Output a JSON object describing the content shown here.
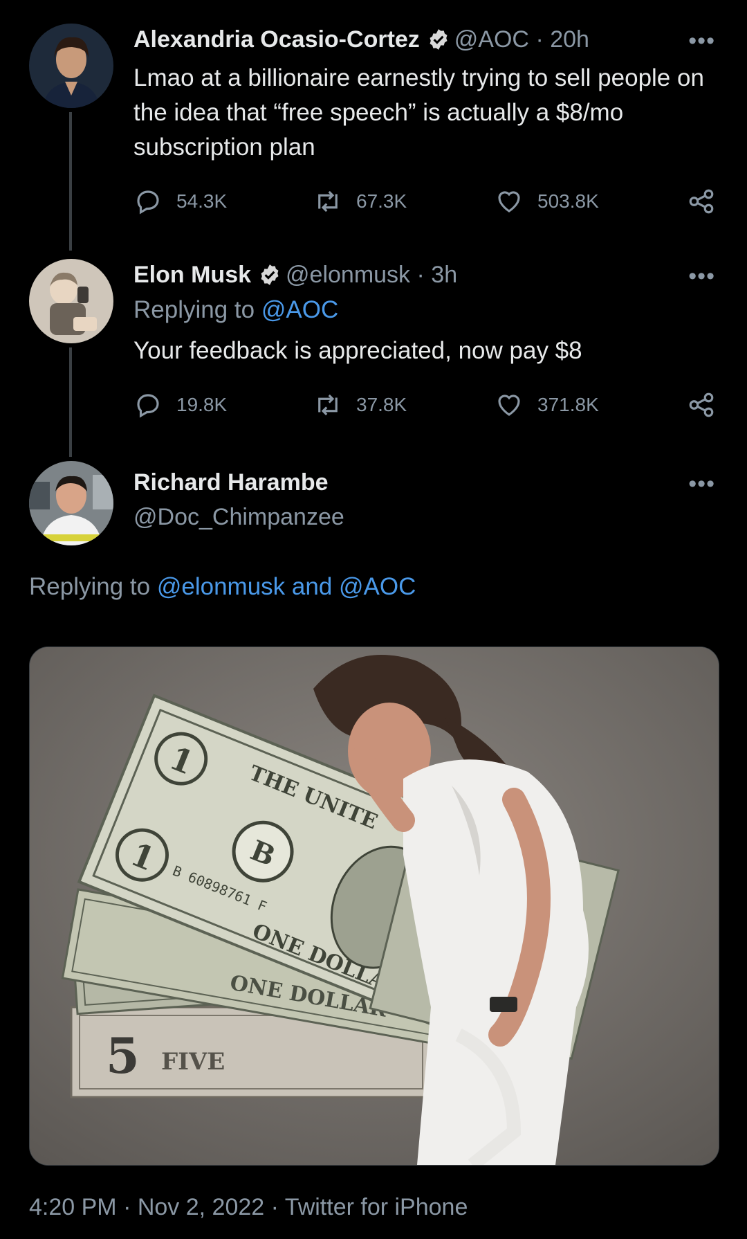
{
  "tweets": [
    {
      "name": "Alexandria Ocasio-Cortez",
      "handle": "@AOC",
      "time": "· 20h",
      "text": "Lmao at a billionaire earnestly trying to sell people on the idea that “free speech” is actually a $8/mo subscription plan",
      "replies": "54.3K",
      "retweets": "67.3K",
      "likes": "503.8K"
    },
    {
      "name": "Elon Musk",
      "handle": "@elonmusk",
      "time": "· 3h",
      "replying_prefix": "Replying to",
      "replying_to": "@AOC",
      "text": "Your feedback is appreciated, now pay $8",
      "replies": "19.8K",
      "retweets": "37.8K",
      "likes": "371.8K"
    },
    {
      "name": "Richard Harambe",
      "handle": "@Doc_Chimpanzee",
      "replying_prefix": "Replying to",
      "replying_to": "@elonmusk and @AOC"
    }
  ],
  "more_glyph": "•••",
  "media": {
    "bill_text_1": "THE UNITE",
    "bill_text_2": "ONE DOLLAR",
    "bill_text_3": "FIVE",
    "bill_serial": "B 60898761 F"
  },
  "footer": {
    "time": "4:20 PM",
    "date": "· Nov 2, 2022",
    "source": "· Twitter for iPhone"
  },
  "colors": {
    "background": "#000000",
    "link": "#4a99e9",
    "muted": "#8b98a5",
    "verified": "#d9d9d9"
  },
  "icons": [
    "reply-icon",
    "retweet-icon",
    "like-icon",
    "share-icon",
    "verified-icon",
    "more-icon"
  ]
}
